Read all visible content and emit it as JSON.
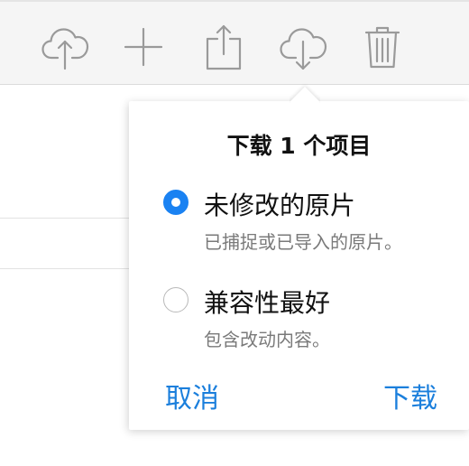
{
  "toolbar": {
    "icons": [
      "cloud-upload-icon",
      "plus-icon",
      "share-icon",
      "cloud-download-icon",
      "trash-icon"
    ]
  },
  "popover": {
    "title": "下载 1 个项目",
    "options": [
      {
        "label": "未修改的原片",
        "description": "已捕捉或已导入的原片。",
        "selected": true
      },
      {
        "label": "兼容性最好",
        "description": "包含改动内容。",
        "selected": false
      }
    ],
    "cancel_label": "取消",
    "download_label": "下载"
  },
  "colors": {
    "accent": "#1a82f2",
    "link": "#1b7fdc",
    "toolbar_bg": "#f5f5f5",
    "icon_gray": "#9a9a9a"
  }
}
